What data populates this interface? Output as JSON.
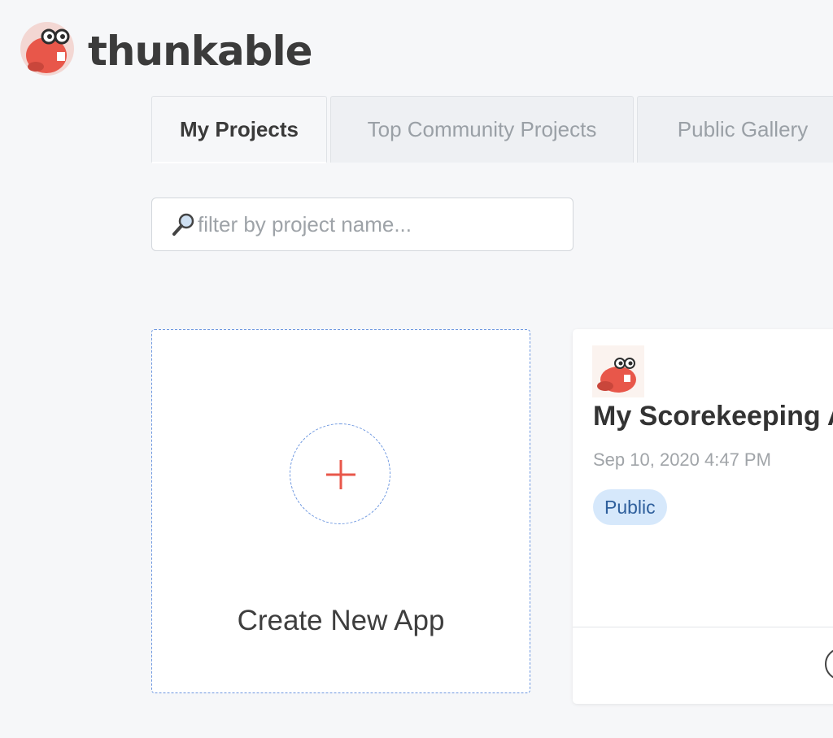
{
  "brand": {
    "name": "thunkable",
    "logo_icon": "beaver-mascot-icon",
    "accent_color": "#e8574a"
  },
  "tabs": [
    {
      "label": "My Projects",
      "active": true
    },
    {
      "label": "Top Community Projects",
      "active": false
    },
    {
      "label": "Public Gallery",
      "active": false
    }
  ],
  "search": {
    "icon": "magnifier-icon",
    "placeholder": "filter by project name...",
    "value": ""
  },
  "create_card": {
    "icon": "plus-icon",
    "label": "Create New App"
  },
  "projects": [
    {
      "icon": "beaver-mascot-icon",
      "title": "My Scorekeeping A",
      "date": "Sep 10, 2020 4:47 PM",
      "badge": "Public",
      "badge_color": "#d6e8fb"
    }
  ]
}
